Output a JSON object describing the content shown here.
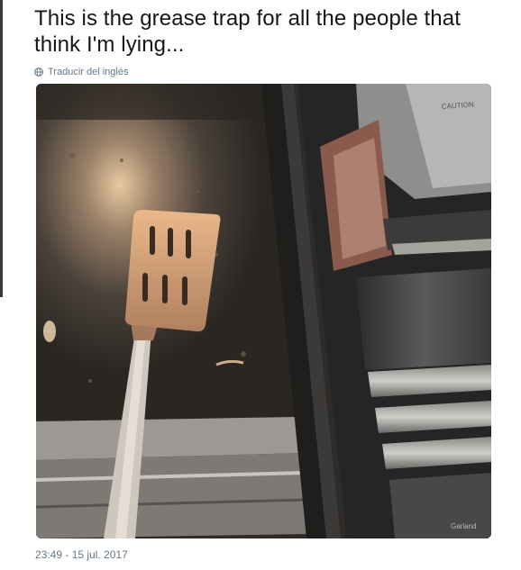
{
  "tweet": {
    "text": "This is the grease trap for all the people that think I'm lying...",
    "translate_label": "Traducir del inglés",
    "timestamp": "23:49 - 15 jul. 2017",
    "translate_icon": "globe-icon"
  },
  "media": {
    "sign_text": "CAUTION",
    "brand_text": "Garland"
  }
}
